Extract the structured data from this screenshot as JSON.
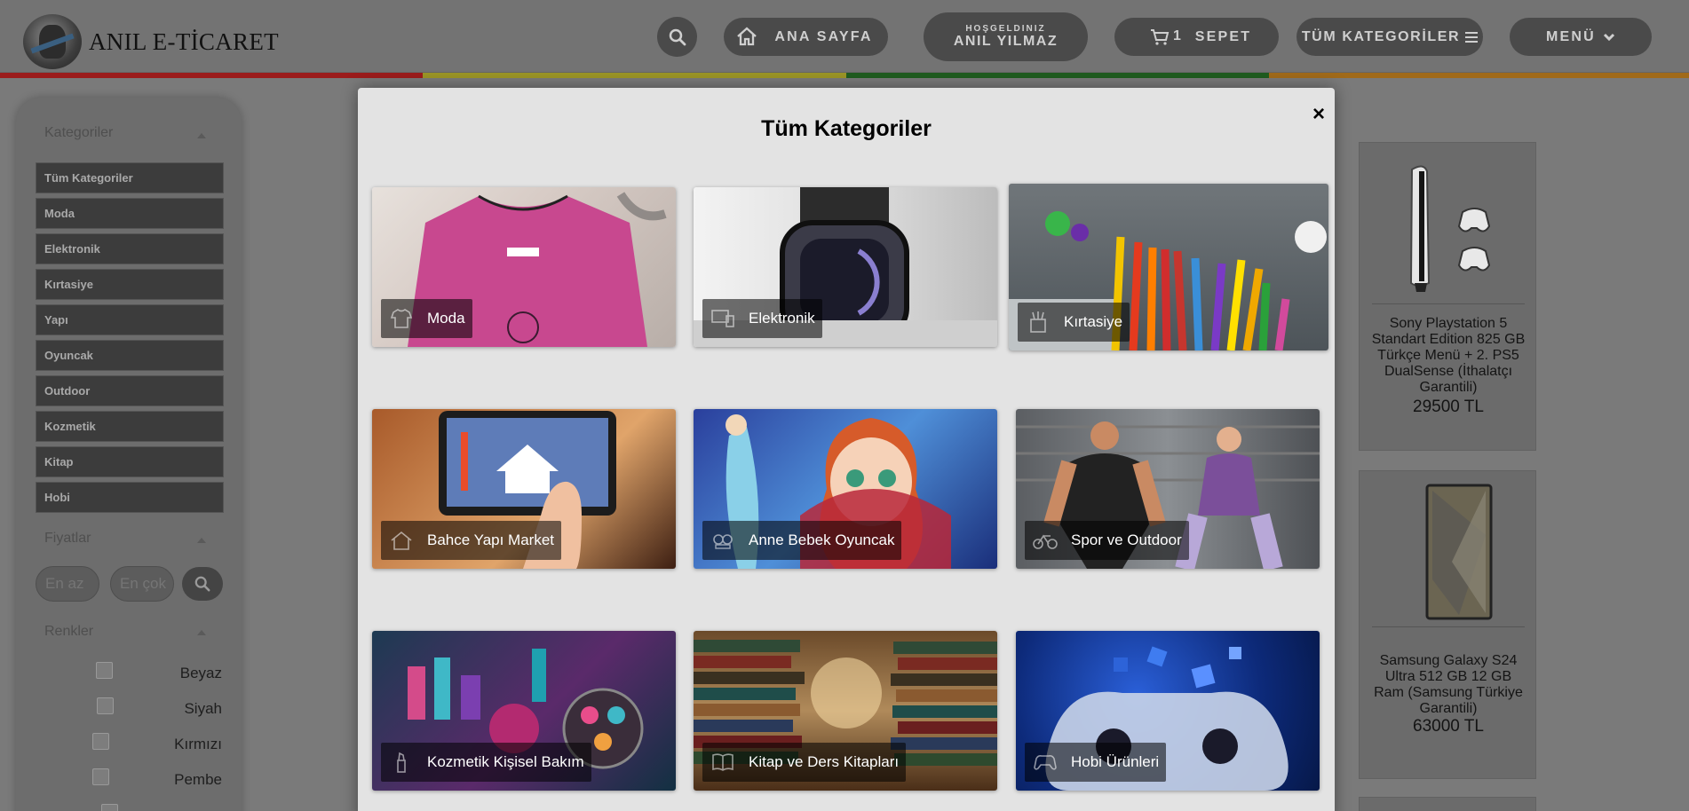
{
  "header": {
    "logo_text": "ANIL E-TİCARET",
    "nav": {
      "home": "ANA SAYFA",
      "welcome_small": "HOŞGELDINIZ",
      "welcome_name": "ANIL YILMAZ",
      "cart_count": "1",
      "cart": "SEPET",
      "all_categories": "TÜM KATEGORİLER",
      "menu": "MENÜ"
    },
    "stripe_colors": [
      "#9b1c1c",
      "#9a9426",
      "#1f5c1f",
      "#a06a1a"
    ]
  },
  "sidebar": {
    "categories_title": "Kategoriler",
    "categories": [
      "Tüm Kategoriler",
      "Moda",
      "Elektronik",
      "Kırtasiye",
      "Yapı",
      "Oyuncak",
      "Outdoor",
      "Kozmetik",
      "Kitap",
      "Hobi"
    ],
    "prices_title": "Fiyatlar",
    "price_min_placeholder": "En az",
    "price_max_placeholder": "En çok",
    "colors_title": "Renkler",
    "colors": [
      "Beyaz",
      "Siyah",
      "Kırmızı",
      "Pembe"
    ]
  },
  "products": [
    {
      "title": "Sony Playstation 5 Standart Edition 825 GB Türkçe Menü + 2. PS5 DualSense (İthalatçı Garantili)",
      "price": "29500 TL"
    },
    {
      "title": "Samsung Galaxy S24 Ultra 512 GB 12 GB Ram (Samsung Türkiye Garantili)",
      "price": "63000 TL"
    }
  ],
  "modal": {
    "title": "Tüm Kategoriler",
    "close": "×",
    "tiles": [
      {
        "label": "Moda",
        "icon": "tshirt-icon"
      },
      {
        "label": "Elektronik",
        "icon": "devices-icon"
      },
      {
        "label": "Kırtasiye",
        "icon": "stationery-icon"
      },
      {
        "label": "Bahce Yapı Market",
        "icon": "house-icon"
      },
      {
        "label": "Anne Bebek Oyuncak",
        "icon": "toy-icon"
      },
      {
        "label": "Spor ve Outdoor",
        "icon": "bike-icon"
      },
      {
        "label": "Kozmetik Kişisel Bakım",
        "icon": "cosmetics-icon"
      },
      {
        "label": "Kitap ve Ders Kitapları",
        "icon": "book-icon"
      },
      {
        "label": "Hobi Ürünleri",
        "icon": "gamepad-icon"
      }
    ]
  }
}
